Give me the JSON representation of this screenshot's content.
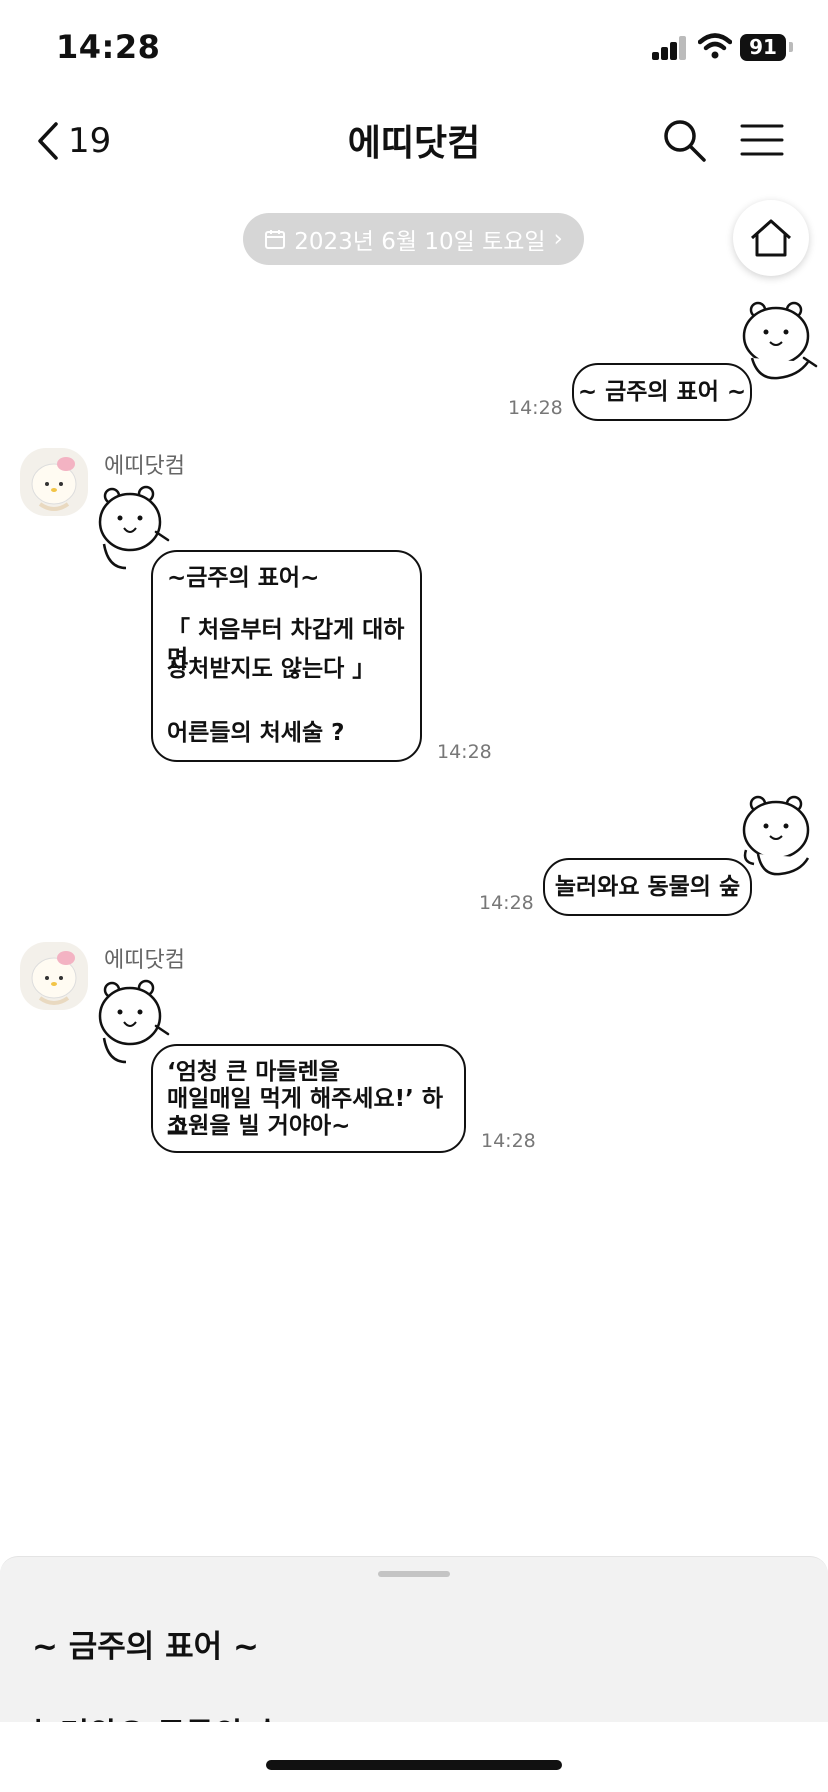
{
  "status_bar": {
    "time": "14:28",
    "battery": "91"
  },
  "header": {
    "back_count": "19",
    "title": "에띠닷컴"
  },
  "date_divider": {
    "label": "2023년 6월 10일 토요일",
    "chevron": "›"
  },
  "messages": [
    {
      "side": "right",
      "text": "~ 금주의 표어 ~",
      "time": "14:28"
    },
    {
      "side": "left",
      "sender": "에띠닷컴",
      "lines": [
        "~금주의 표어~",
        "「 처음부터 차갑게 대하면",
        "상처받지도 않는다 」",
        "어른들의 처세술 ?"
      ],
      "time": "14:28"
    },
    {
      "side": "right",
      "text": "놀러와요 동물의 숲",
      "time": "14:28"
    },
    {
      "side": "left",
      "sender": "에띠닷컴",
      "lines": [
        "‘엄청 큰 마들렌을",
        "매일매일 먹게 해주세요!’ 하고",
        "소원을 빌 거야아~"
      ],
      "time": "14:28"
    }
  ],
  "bottom_sheet": {
    "items": [
      "~ 금주의 표어 ~",
      "놀러와요 동물의 숲"
    ]
  },
  "icons": {
    "back": "chevron-left-icon",
    "search": "search-icon",
    "menu": "hamburger-menu-icon",
    "home": "home-icon",
    "calendar": "calendar-icon",
    "sticker": "bear-sticker-icon",
    "avatar": "kitty-avatar-icon"
  },
  "colors": {
    "date_pill": "#d6d6d6",
    "bubble_border": "#111111",
    "sheet_bg": "#f2f2f2",
    "time_text": "#777777"
  }
}
